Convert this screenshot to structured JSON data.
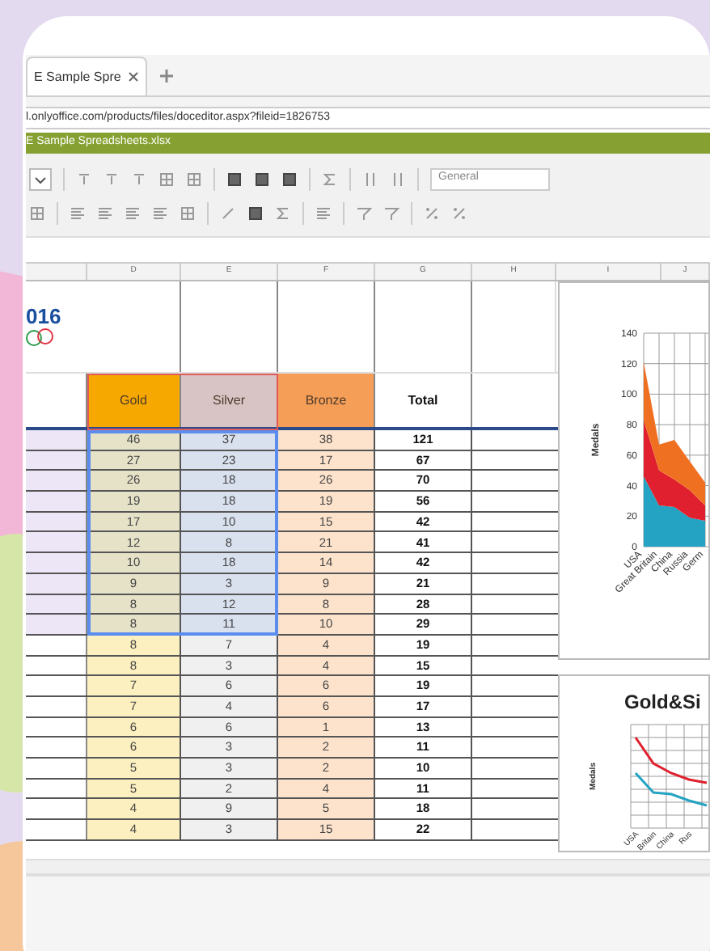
{
  "browser": {
    "tab": {
      "title": "E Sample Spre"
    },
    "address": "l.onlyoffice.com/products/files/doceditor.aspx?fileid=1826753"
  },
  "editor": {
    "title": "E Sample Spreadsheets.xlsx",
    "number_format": "General"
  },
  "sheet": {
    "columns": [
      "D",
      "E",
      "F",
      "G",
      "H",
      "I",
      "J"
    ],
    "logo": "016",
    "headers": [
      {
        "label": "Gold",
        "color": "#f7a800"
      },
      {
        "label": "Silver",
        "color": "#d8c4c4"
      },
      {
        "label": "Bronze",
        "color": "#f59e58"
      },
      {
        "label": "Total",
        "color": "#ffffff"
      }
    ],
    "rows": [
      {
        "selected": true,
        "values": [
          "46",
          "37",
          "38",
          "121"
        ]
      },
      {
        "selected": true,
        "values": [
          "27",
          "23",
          "17",
          "67"
        ]
      },
      {
        "selected": true,
        "values": [
          "26",
          "18",
          "26",
          "70"
        ]
      },
      {
        "selected": true,
        "values": [
          "19",
          "18",
          "19",
          "56"
        ]
      },
      {
        "selected": true,
        "values": [
          "17",
          "10",
          "15",
          "42"
        ]
      },
      {
        "selected": true,
        "values": [
          "12",
          "8",
          "21",
          "41"
        ]
      },
      {
        "selected": true,
        "values": [
          "10",
          "18",
          "14",
          "42"
        ]
      },
      {
        "selected": true,
        "values": [
          "9",
          "3",
          "9",
          "21"
        ]
      },
      {
        "selected": true,
        "values": [
          "8",
          "12",
          "8",
          "28"
        ]
      },
      {
        "selected": true,
        "values": [
          "8",
          "11",
          "10",
          "29"
        ]
      },
      {
        "selected": false,
        "values": [
          "8",
          "7",
          "4",
          "19"
        ]
      },
      {
        "selected": false,
        "values": [
          "8",
          "3",
          "4",
          "15"
        ]
      },
      {
        "selected": false,
        "values": [
          "7",
          "6",
          "6",
          "19"
        ]
      },
      {
        "selected": false,
        "values": [
          "7",
          "4",
          "6",
          "17"
        ]
      },
      {
        "selected": false,
        "values": [
          "6",
          "6",
          "1",
          "13"
        ]
      },
      {
        "selected": false,
        "values": [
          "6",
          "3",
          "2",
          "11"
        ]
      },
      {
        "selected": false,
        "values": [
          "5",
          "3",
          "2",
          "10"
        ]
      },
      {
        "selected": false,
        "values": [
          "5",
          "2",
          "4",
          "11"
        ]
      },
      {
        "selected": false,
        "values": [
          "4",
          "9",
          "5",
          "18"
        ]
      },
      {
        "selected": false,
        "values": [
          "4",
          "3",
          "15",
          "22"
        ]
      }
    ]
  },
  "area_chart": {
    "chart_data": {
      "type": "area",
      "stacked": true,
      "grid": true,
      "ylabel": "Medals",
      "categories": [
        "USA",
        "Great Britain",
        "China",
        "Russia",
        "Germ"
      ],
      "yticks": [
        0,
        20,
        40,
        60,
        80,
        100,
        120,
        140
      ],
      "ylim": [
        0,
        140
      ],
      "series": [
        {
          "color": "#24a3c2",
          "values": [
            46,
            27,
            26,
            19,
            17
          ]
        },
        {
          "color": "#e0202e",
          "values": [
            37,
            23,
            18,
            18,
            10
          ]
        },
        {
          "color": "#f07022",
          "values": [
            38,
            17,
            26,
            19,
            15
          ]
        }
      ]
    }
  },
  "line_chart": {
    "title": "Gold&Si",
    "ylabel": "Medals",
    "categories": [
      "USA",
      "Britain",
      "China",
      "Rus"
    ],
    "series": [
      {
        "color": "#e0202e"
      },
      {
        "color": "#24a3c2"
      }
    ]
  }
}
